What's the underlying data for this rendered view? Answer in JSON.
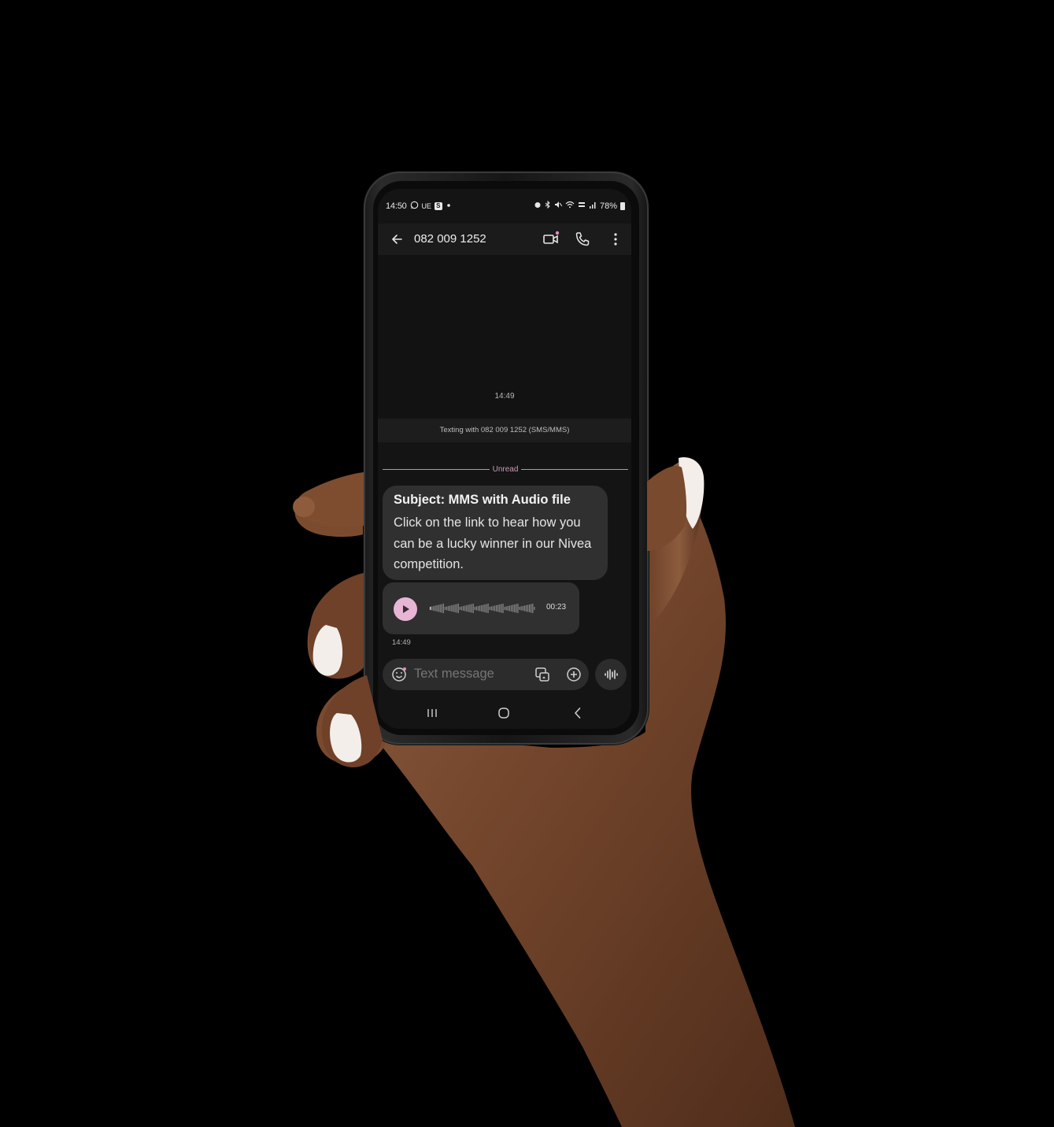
{
  "status_bar": {
    "time": "14:50",
    "left_icons": [
      "whatsapp-icon",
      "ue",
      "s-app-icon",
      "dot"
    ],
    "left_ue": "UE",
    "left_s": "S",
    "battery": "78%",
    "right_icons": [
      "alarm-icon",
      "bluetooth-icon",
      "mute-icon",
      "wifi-icon",
      "lte-icon",
      "signal-icon",
      "battery-icon"
    ]
  },
  "app_bar": {
    "title": "082 009 1252",
    "actions": [
      "video-call-icon",
      "phone-call-icon",
      "more-vert-icon"
    ]
  },
  "conversation": {
    "first_timestamp": "14:49",
    "texting_banner": "Texting with 082 009 1252 (SMS/MMS)",
    "unread_label": "Unread",
    "message": {
      "subject": "Subject: MMS with Audio file",
      "body": "Click on the link to hear how you can be a lucky winner in our Nivea competition."
    },
    "audio": {
      "duration": "00:23",
      "progress": 0
    },
    "message_time": "14:49"
  },
  "compose": {
    "placeholder": "Text message"
  },
  "colors": {
    "accent": "#e7b6d4",
    "unread_line": "#c28fb0",
    "bubble": "#303030",
    "screen_bg": "#141414"
  }
}
